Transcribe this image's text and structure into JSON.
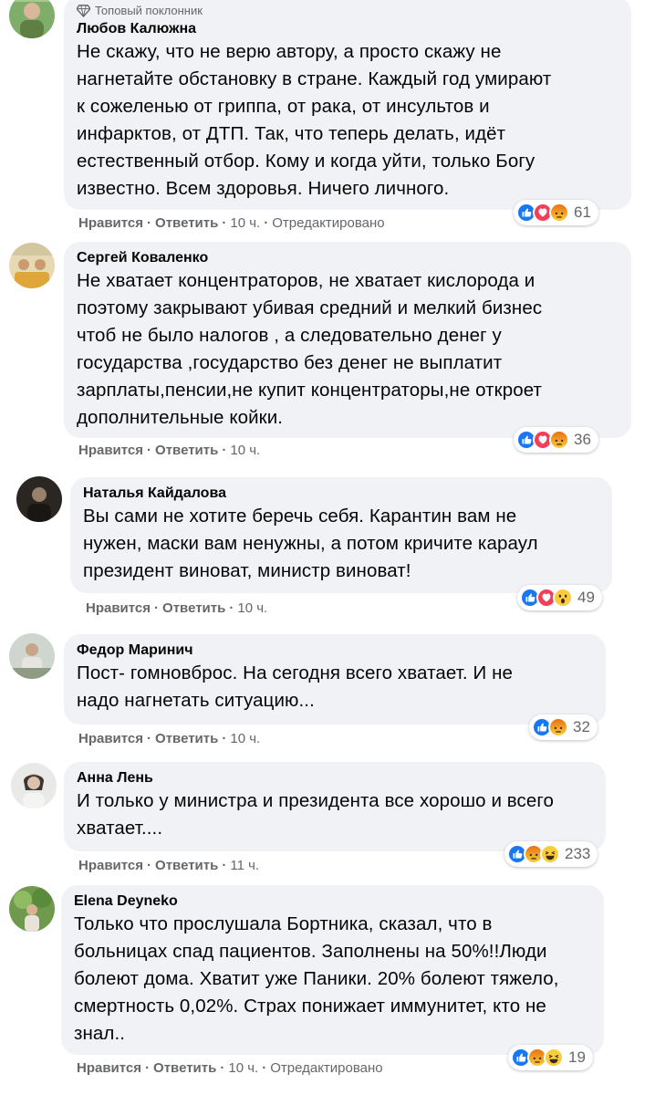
{
  "comments": [
    {
      "badge": "Топовый поклонник",
      "author": "Любов Калюжна",
      "text": "Не скажу, что не верю автору, а просто скажу не\nнагнетайте обстановку в стране. Каждый год умирают\nк сожеленью от гриппа, от рака, от инсультов и\nинфарктов, от ДТП. Так, что теперь делать, идёт\nестественный отбор. Кому и когда уйти, только Богу\nизвестно. Всем здоровья. Ничего личного.",
      "like": "Нравится",
      "reply": "Ответить",
      "time": "10 ч.",
      "edited": "Отредактировано",
      "reaction_count": "61",
      "reaction_icons": [
        "like-icon",
        "love-icon",
        "angry-icon"
      ]
    },
    {
      "author": "Сергей Коваленко",
      "text": "Не хватает концентраторов, не хватает кислорода и\nпоэтому закрывают убивая средний и мелкий бизнес\nчтоб не было налогов , а следовательно денег у\nгосударства ,государство без денег не выплатит\nзарплаты,пенсии,не купит концентраторы,не откроет\nдополнительные койки.",
      "like": "Нравится",
      "reply": "Ответить",
      "time": "10 ч.",
      "reaction_count": "36",
      "reaction_icons": [
        "like-icon",
        "love-icon",
        "angry-icon"
      ]
    },
    {
      "author": "Наталья Кайдалова",
      "text": "Вы сами не хотите беречь себя. Карантин вам не\nнужен, маски вам ненужны, а потом кричите караул\nпрезидент виноват, министр виноват!",
      "like": "Нравится",
      "reply": "Ответить",
      "time": "10 ч.",
      "reaction_count": "49",
      "reaction_icons": [
        "like-icon",
        "love-icon",
        "wow-icon"
      ]
    },
    {
      "author": "Федор Маринич",
      "text": "Пост- гомновброс. На сегодня всего хватает. И не\nнадо нагнетать ситуацию...",
      "like": "Нравится",
      "reply": "Ответить",
      "time": "10 ч.",
      "reaction_count": "32",
      "reaction_icons": [
        "like-icon",
        "angry-icon"
      ]
    },
    {
      "author": "Анна Лень",
      "text": "И только у министра и президента все хорошо и всего\nхватает....",
      "like": "Нравится",
      "reply": "Ответить",
      "time": "11 ч.",
      "reaction_count": "233",
      "reaction_icons": [
        "like-icon",
        "angry-icon",
        "haha-icon"
      ]
    },
    {
      "author": "Elena Deyneko",
      "text": "Только что прослушала Бортника, сказал, что в\nбольницах спад пациентов. Заполнены на 50%!!Люди\nболеют дома. Хватит уже Паники. 20% болеют тяжело,\nсмертность 0,02%. Страх понижает иммунитет, кто не\nзнал..",
      "like": "Нравится",
      "reply": "Ответить",
      "time": "10 ч.",
      "edited": "Отредактировано",
      "reaction_count": "19",
      "reaction_icons": [
        "like-icon",
        "angry-icon",
        "haha-icon"
      ]
    }
  ],
  "colors": {
    "like": "#1877f2",
    "love": "#f33e58",
    "angry": "#e9710f",
    "reaction_yellow": "#fbcd3c",
    "bubble": "#f0f2f5",
    "secondary_text": "#65676b"
  }
}
